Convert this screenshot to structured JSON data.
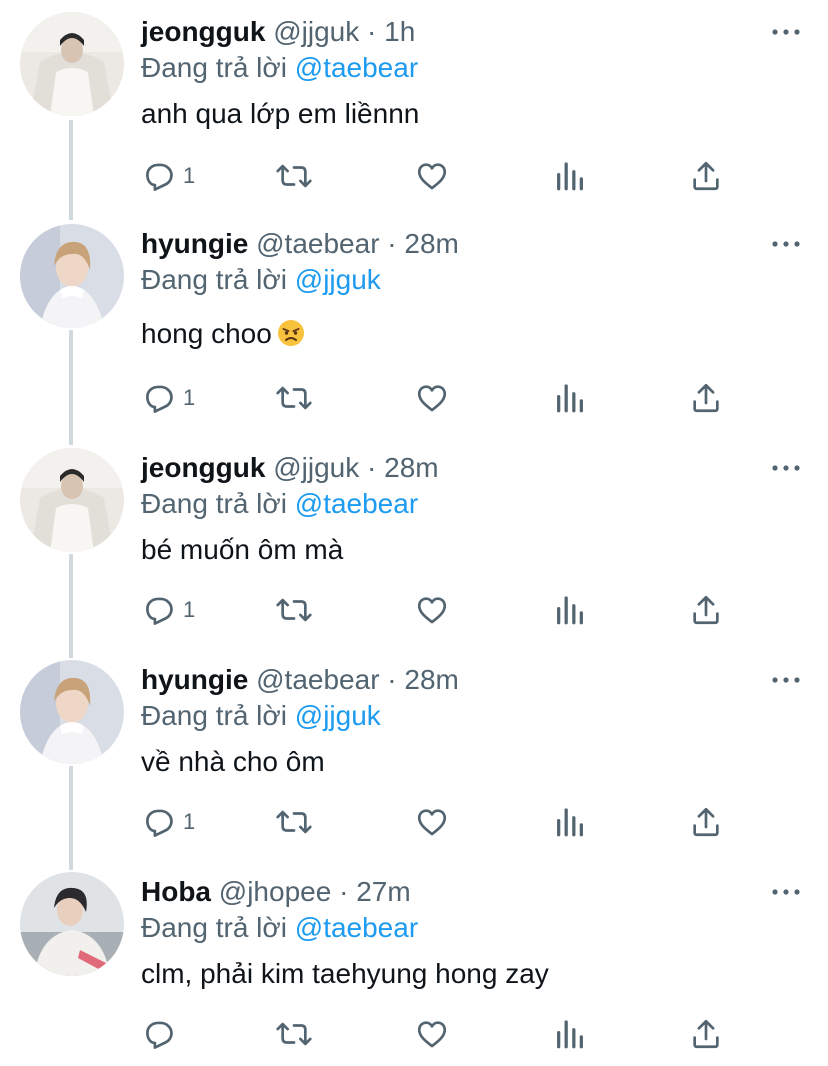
{
  "colors": {
    "accent": "#1d9bf0",
    "secondary_text": "#536471",
    "thread_line": "#cfd9de"
  },
  "tweets": [
    {
      "name": "jeongguk",
      "handle": "@jjguk",
      "sep": "·",
      "time": "1h",
      "reply_prefix": "Đang trả lời",
      "reply_to": "@taebear",
      "text": "anh qua lớp em liềnnn",
      "reply_count": "1",
      "avatar": "jeongguk-avatar"
    },
    {
      "name": "hyungie",
      "handle": "@taebear",
      "sep": "·",
      "time": "28m",
      "reply_prefix": "Đang trả lời",
      "reply_to": "@jjguk",
      "text": "hong choo",
      "emoji": "angry-face-emoji",
      "reply_count": "1",
      "avatar": "hyungie-avatar"
    },
    {
      "name": "jeongguk",
      "handle": "@jjguk",
      "sep": "·",
      "time": "28m",
      "reply_prefix": "Đang trả lời",
      "reply_to": "@taebear",
      "text": "bé muốn ôm mà",
      "reply_count": "1",
      "avatar": "jeongguk-avatar"
    },
    {
      "name": "hyungie",
      "handle": "@taebear",
      "sep": "·",
      "time": "28m",
      "reply_prefix": "Đang trả lời",
      "reply_to": "@jjguk",
      "text": "về nhà cho ôm",
      "reply_count": "1",
      "avatar": "hyungie-avatar"
    },
    {
      "name": "Hoba",
      "handle": "@jhopee",
      "sep": "·",
      "time": "27m",
      "reply_prefix": "Đang trả lời",
      "reply_to": "@taebear",
      "text": "clm, phải kim taehyung hong zay",
      "reply_count": "",
      "avatar": "hoba-avatar"
    }
  ],
  "icons": [
    "reply-icon",
    "retweet-icon",
    "like-icon",
    "analytics-icon",
    "share-icon",
    "more-icon"
  ]
}
